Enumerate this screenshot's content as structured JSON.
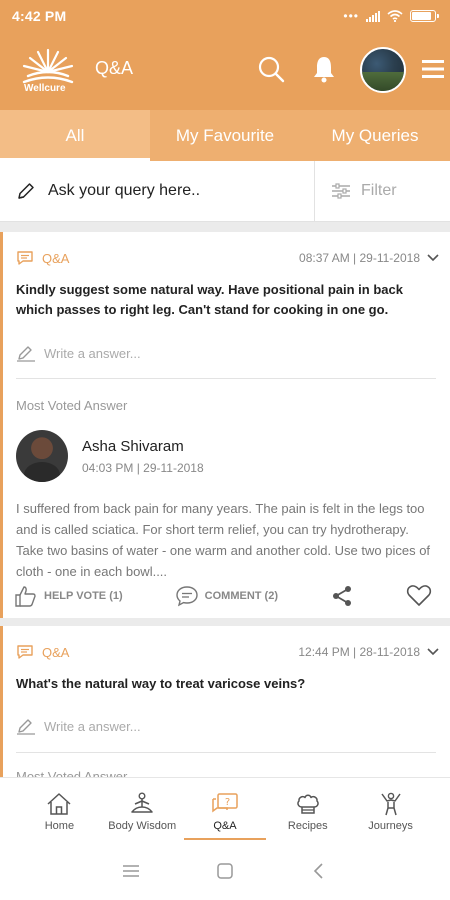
{
  "status_bar": {
    "time": "4:42 PM",
    "battery_level": 0.85
  },
  "header": {
    "brand": "Wellcure",
    "title": "Q&A",
    "colors": {
      "primary": "#e8a15c",
      "tab_bg": "#eeaf70"
    }
  },
  "tabs": [
    {
      "label": "All",
      "active": true
    },
    {
      "label": "My Favourite",
      "active": false
    },
    {
      "label": "My Queries",
      "active": false
    }
  ],
  "search": {
    "placeholder": "Ask your query here..",
    "filter_label": "Filter"
  },
  "posts": [
    {
      "type": "Q&A",
      "datetime": "08:37 AM | 29-11-2018",
      "question": "Kindly suggest some natural way. Have positional pain in back which passes to right leg. Can't stand for cooking in one go.",
      "write_placeholder": "Write a answer...",
      "most_voted_label": "Most Voted Answer",
      "answer": {
        "author": "Asha Shivaram",
        "datetime": "04:03 PM | 29-11-2018",
        "text": "I suffered from back pain for many years. The pain is felt in the legs too and is called sciatica.  For short term relief, you can try hydrotherapy. Take two basins of water - one warm and another cold. Use two pices of cloth - one in each bowl...."
      },
      "actions": {
        "help_vote": "HELP VOTE (1)",
        "comment": "COMMENT (2)"
      }
    },
    {
      "type": "Q&A",
      "datetime": "12:44 PM | 28-11-2018",
      "question": "What's the natural way to treat varicose veins?",
      "write_placeholder": "Write a answer...",
      "most_voted_label": "Most Voted Answer"
    }
  ],
  "bottom_nav": [
    {
      "label": "Home",
      "icon": "home-icon",
      "active": false
    },
    {
      "label": "Body Wisdom",
      "icon": "meditation-icon",
      "active": false
    },
    {
      "label": "Q&A",
      "icon": "qa-icon",
      "active": true
    },
    {
      "label": "Recipes",
      "icon": "chef-hat-icon",
      "active": false
    },
    {
      "label": "Journeys",
      "icon": "journey-icon",
      "active": false
    }
  ]
}
